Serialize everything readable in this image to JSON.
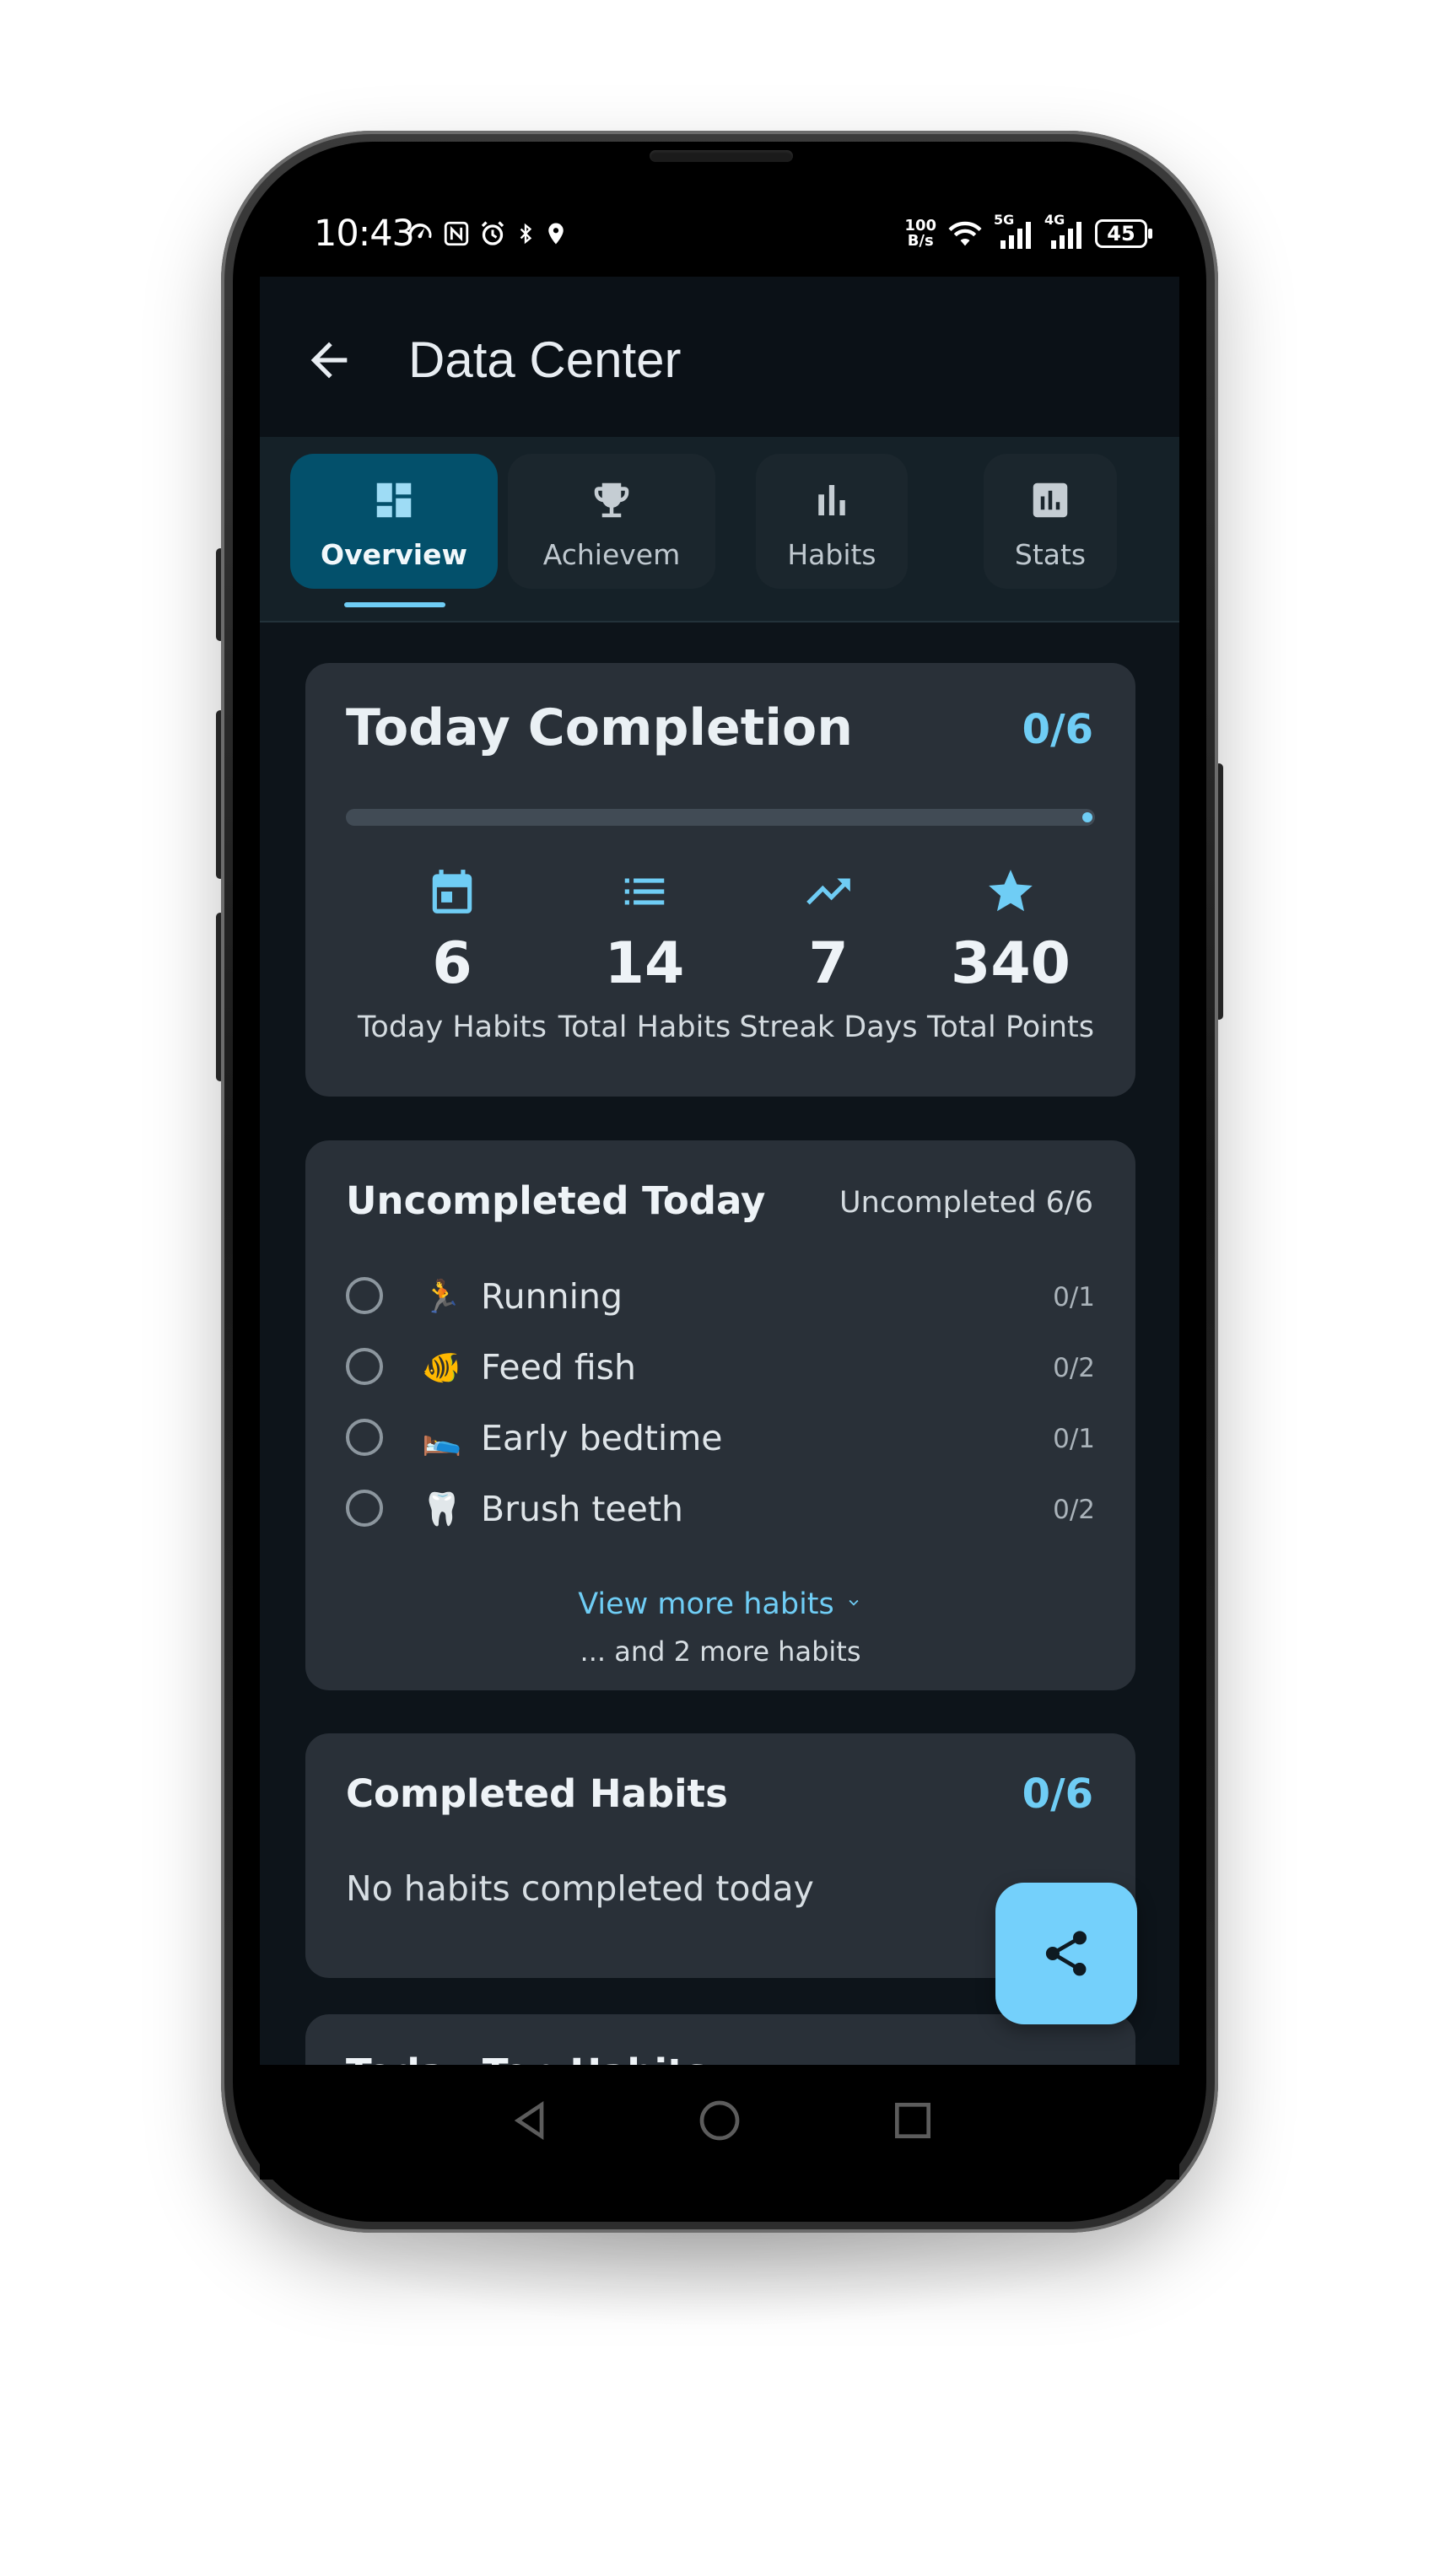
{
  "status_bar": {
    "time": "10:43",
    "net_speed_value": "100",
    "net_speed_unit": "B/s",
    "signal_1": "5G",
    "signal_2": "4G",
    "battery": "45"
  },
  "app_bar": {
    "title": "Data Center",
    "back_icon": "arrow-left-icon"
  },
  "tabs": [
    {
      "label": "Overview",
      "icon": "dashboard-icon",
      "active": true
    },
    {
      "label": "Achievem",
      "icon": "trophy-icon",
      "active": false
    },
    {
      "label": "Habits",
      "icon": "bar-chart-icon",
      "active": false
    },
    {
      "label": "Stats",
      "icon": "analytics-icon",
      "active": false
    }
  ],
  "today_completion": {
    "title": "Today Completion",
    "ratio": "0/6",
    "progress": 0,
    "stats": [
      {
        "value": "6",
        "label": "Today Habits",
        "icon": "calendar-icon"
      },
      {
        "value": "14",
        "label": "Total Habits",
        "icon": "list-icon"
      },
      {
        "value": "7",
        "label": "Streak Days",
        "icon": "trending-up-icon"
      },
      {
        "value": "340",
        "label": "Total Points",
        "icon": "star-icon"
      }
    ]
  },
  "uncompleted": {
    "title": "Uncompleted Today",
    "count_label": "Uncompleted 6/6",
    "items": [
      {
        "emoji": "🏃",
        "name": "Running",
        "progress": "0/1"
      },
      {
        "emoji": "🐠",
        "name": "Feed fish",
        "progress": "0/2"
      },
      {
        "emoji": "🛌",
        "name": "Early bedtime",
        "progress": "0/1"
      },
      {
        "emoji": "🦷",
        "name": "Brush teeth",
        "progress": "0/2"
      }
    ],
    "view_more": "View more habits",
    "more_note": "... and 2 more habits"
  },
  "completed": {
    "title": "Completed Habits",
    "ratio": "0/6",
    "empty_text": "No habits completed today"
  },
  "next_card": {
    "title": "Today Top Habits"
  },
  "fab": {
    "icon": "share-icon"
  },
  "colors": {
    "accent": "#6fcdf5",
    "card": "#293038",
    "background": "#0d141a",
    "active_tab": "#03506b"
  }
}
